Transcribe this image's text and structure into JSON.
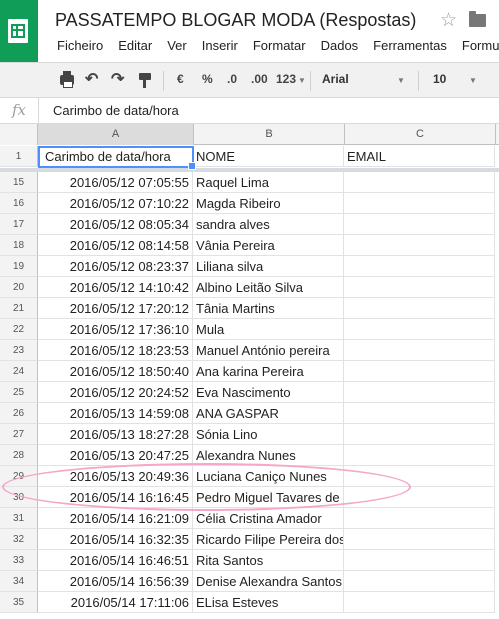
{
  "app": {
    "title": "PASSATEMPO BLOGAR MODA (Respostas)",
    "accent_color": "#0f9d58",
    "header_icons": [
      "sheets-logo-icon",
      "star-icon",
      "folder-icon"
    ]
  },
  "menu": [
    "Ficheiro",
    "Editar",
    "Ver",
    "Inserir",
    "Formatar",
    "Dados",
    "Ferramentas",
    "Formu"
  ],
  "toolbar": {
    "currency": "€",
    "percent": "%",
    "decrease_decimals": ".0",
    "increase_decimals": ".00",
    "number_format": "123",
    "font": "Arial",
    "font_size": "10",
    "icons": [
      "print-icon",
      "undo-icon",
      "redo-icon",
      "paint-format-icon"
    ]
  },
  "formula_bar": {
    "fx": "fx",
    "value": "Carimbo de data/hora"
  },
  "columns": [
    "A",
    "B",
    "C"
  ],
  "header_row": {
    "num": "1",
    "cells": [
      "Carimbo de data/hora",
      "NOME",
      "EMAIL"
    ]
  },
  "rows": [
    {
      "num": "15",
      "a": "2016/05/12 07:05:55",
      "b": "Raquel Lima"
    },
    {
      "num": "16",
      "a": "2016/05/12 07:10:22",
      "b": "Magda Ribeiro"
    },
    {
      "num": "17",
      "a": "2016/05/12 08:05:34",
      "b": "sandra alves"
    },
    {
      "num": "18",
      "a": "2016/05/12 08:14:58",
      "b": "Vânia Pereira"
    },
    {
      "num": "19",
      "a": "2016/05/12 08:23:37",
      "b": "Liliana silva"
    },
    {
      "num": "20",
      "a": "2016/05/12 14:10:42",
      "b": "Albino Leitão Silva"
    },
    {
      "num": "21",
      "a": "2016/05/12 17:20:12",
      "b": "Tânia Martins"
    },
    {
      "num": "22",
      "a": "2016/05/12 17:36:10",
      "b": "Mula"
    },
    {
      "num": "23",
      "a": "2016/05/12 18:23:53",
      "b": "Manuel António pereira"
    },
    {
      "num": "24",
      "a": "2016/05/12 18:50:40",
      "b": "Ana karina Pereira"
    },
    {
      "num": "25",
      "a": "2016/05/12 20:24:52",
      "b": "Eva Nascimento"
    },
    {
      "num": "26",
      "a": "2016/05/13 14:59:08",
      "b": "ANA GASPAR"
    },
    {
      "num": "27",
      "a": "2016/05/13 18:27:28",
      "b": "Sónia Lino"
    },
    {
      "num": "28",
      "a": "2016/05/13 20:47:25",
      "b": "Alexandra Nunes"
    },
    {
      "num": "29",
      "a": "2016/05/13 20:49:36",
      "b": "Luciana Caniço Nunes"
    },
    {
      "num": "30",
      "a": "2016/05/14 16:16:45",
      "b": "Pedro Miguel Tavares de"
    },
    {
      "num": "31",
      "a": "2016/05/14 16:21:09",
      "b": "Célia Cristina Amador"
    },
    {
      "num": "32",
      "a": "2016/05/14 16:32:35",
      "b": "Ricardo Filipe Pereira dos"
    },
    {
      "num": "33",
      "a": "2016/05/14 16:46:51",
      "b": "Rita Santos"
    },
    {
      "num": "34",
      "a": "2016/05/14 16:56:39",
      "b": "Denise Alexandra Santos"
    },
    {
      "num": "35",
      "a": "2016/05/14 17:11:06",
      "b": "ELisa Esteves"
    }
  ]
}
